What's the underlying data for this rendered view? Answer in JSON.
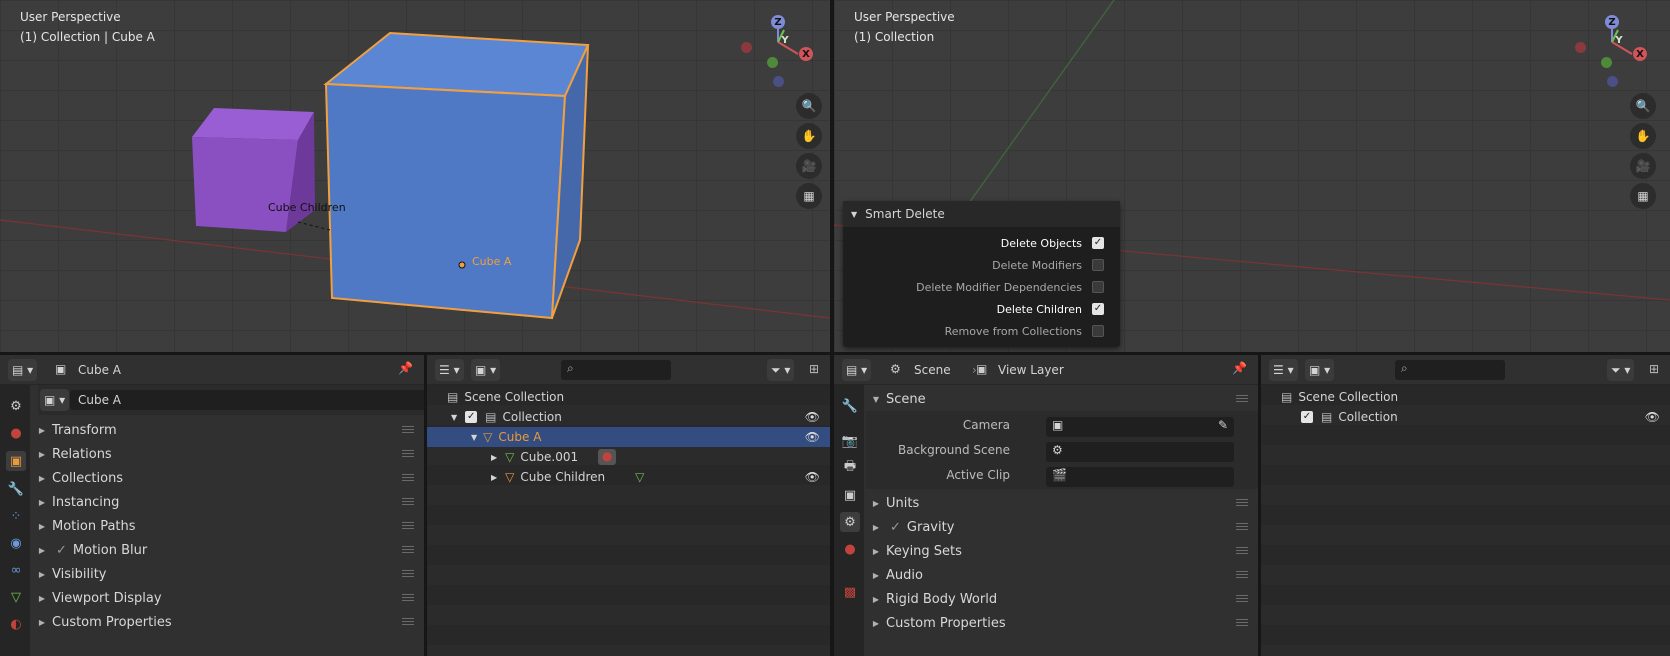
{
  "left_viewport": {
    "perspective": "User Perspective",
    "collection": "(1) Collection | Cube A",
    "labels": {
      "cube_children": "Cube  Children",
      "cube_a": "Cube A"
    }
  },
  "right_viewport": {
    "perspective": "User Perspective",
    "collection": "(1) Collection"
  },
  "axes": {
    "z": "Z",
    "y": "Y",
    "x": "X"
  },
  "smart_delete": {
    "title": "Smart Delete",
    "options": [
      {
        "label": "Delete Objects",
        "checked": true
      },
      {
        "label": "Delete Modifiers",
        "checked": false
      },
      {
        "label": "Delete Modifier Dependencies",
        "checked": false
      },
      {
        "label": "Delete Children",
        "checked": true
      },
      {
        "label": "Remove from Collections",
        "checked": false
      }
    ]
  },
  "left_props": {
    "object_name": "Cube A",
    "name_field": "Cube A",
    "sections": [
      "Transform",
      "Relations",
      "Collections",
      "Instancing",
      "Motion Paths",
      "Motion Blur",
      "Visibility",
      "Viewport Display",
      "Custom Properties"
    ]
  },
  "left_outliner": {
    "root": "Scene Collection",
    "collection": "Collection",
    "cube_a": "Cube A",
    "cube001": "Cube.001",
    "cube_children": "Cube  Children"
  },
  "right_props": {
    "scene": "Scene",
    "view_layer": "View Layer",
    "panel_title": "Scene",
    "fields": [
      {
        "label": "Camera"
      },
      {
        "label": "Background Scene"
      },
      {
        "label": "Active Clip"
      }
    ],
    "sections": [
      "Units",
      "Gravity",
      "Keying Sets",
      "Audio",
      "Rigid Body World",
      "Custom Properties"
    ]
  },
  "right_outliner": {
    "root": "Scene Collection",
    "collection": "Collection"
  },
  "colors": {
    "accent": "#e89a3c",
    "selection": "#334d80",
    "cube_blue": "#4f79c4",
    "cube_purple": "#8a4fc0"
  }
}
